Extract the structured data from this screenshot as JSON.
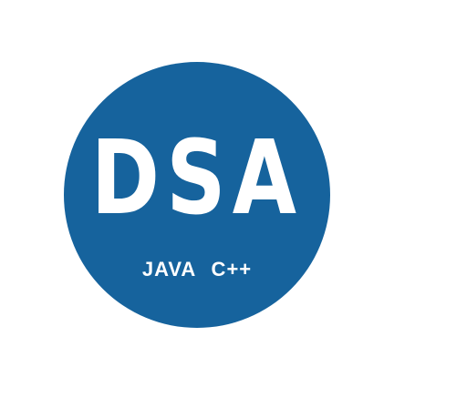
{
  "logo": {
    "title": "DSA",
    "subtitle": "JAVA  C++",
    "background_color": "#16639d",
    "text_color": "#ffffff"
  }
}
